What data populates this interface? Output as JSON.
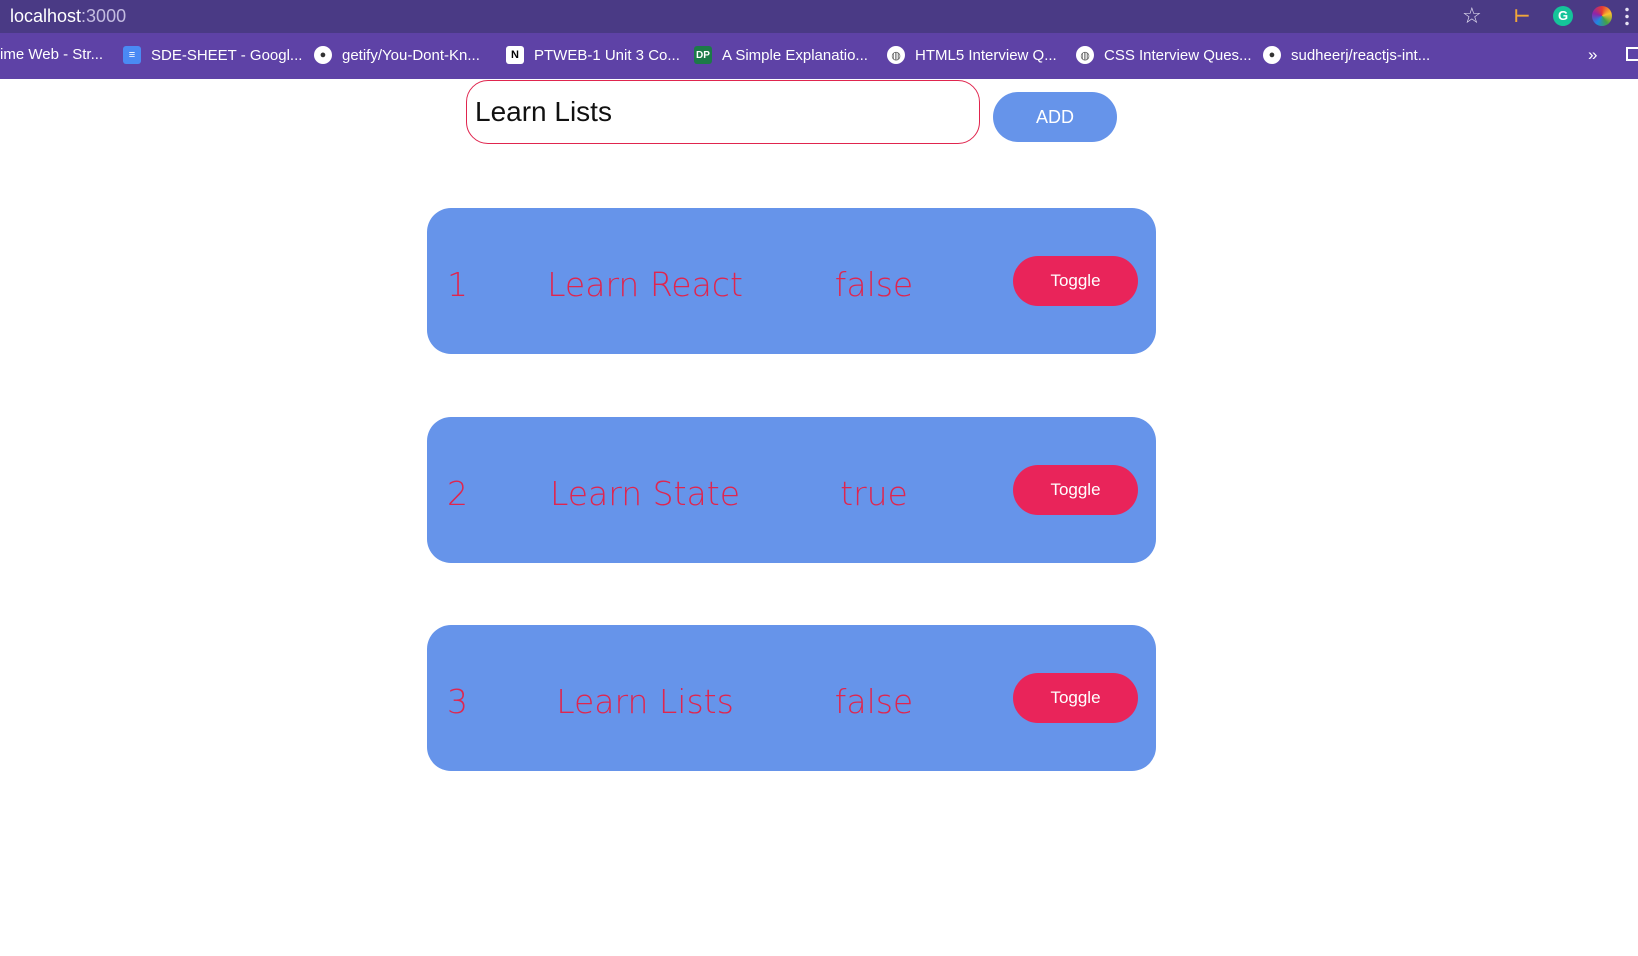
{
  "browser": {
    "url_host": "localhost",
    "url_port": ":3000",
    "bookmarks": [
      {
        "label": "ime Web - Str...",
        "icon": "none"
      },
      {
        "label": "SDE-SHEET - Googl...",
        "icon": "google-docs-icon"
      },
      {
        "label": "getify/You-Dont-Kn...",
        "icon": "github-icon"
      },
      {
        "label": "PTWEB-1 Unit 3 Co...",
        "icon": "notion-icon"
      },
      {
        "label": "A Simple Explanatio...",
        "icon": "dp-icon"
      },
      {
        "label": "HTML5 Interview Q...",
        "icon": "globe-icon"
      },
      {
        "label": "CSS Interview Ques...",
        "icon": "globe-icon"
      },
      {
        "label": "sudheerj/reactjs-int...",
        "icon": "github-icon"
      }
    ],
    "bookmarks_overflow": "»"
  },
  "app": {
    "input_value": "Learn Lists",
    "add_label": "ADD",
    "todos": [
      {
        "id": "1",
        "title": "Learn React",
        "status": "false",
        "toggle_label": "Toggle"
      },
      {
        "id": "2",
        "title": "Learn State",
        "status": "true",
        "toggle_label": "Toggle"
      },
      {
        "id": "3",
        "title": "Learn Lists",
        "status": "false",
        "toggle_label": "Toggle"
      }
    ]
  },
  "colors": {
    "chrome_top": "#4a3a85",
    "bookmark_bar": "#5e42a6",
    "card_bg": "#6694ea",
    "accent_red": "#e0254e",
    "toggle_bg": "#e9245a"
  }
}
